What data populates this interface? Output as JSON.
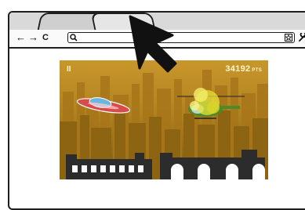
{
  "browser": {
    "nav": {
      "back": "←",
      "forward": "→",
      "reload": "C"
    },
    "address": {
      "value": "",
      "placeholder": ""
    },
    "icons": [
      "search-icon",
      "star-icon",
      "wrench-icon"
    ]
  },
  "game": {
    "score_value": "34192",
    "score_unit": "PTS",
    "pause_label": "II",
    "colors": {
      "sky_top": "#c9962c",
      "sky_bottom": "#7a5a10",
      "buildings": "#7a5a0e",
      "rooftops": "#2c2c2c",
      "ufo": "#d94a4a",
      "helicopter": "#4e8a2a"
    }
  }
}
